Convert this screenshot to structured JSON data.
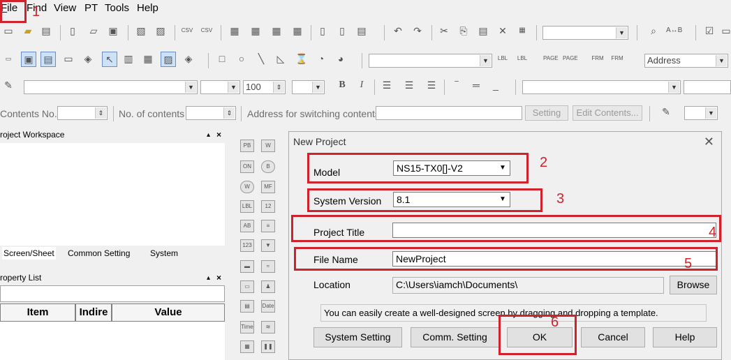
{
  "menu": {
    "file": "File",
    "find": "Find",
    "view": "View",
    "pt": "PT",
    "tools": "Tools",
    "help": "Help"
  },
  "toolbar3": {
    "font_size": "100"
  },
  "toolbar4": {
    "contents_no_label": "Contents No.",
    "no_of_contents_label": "No. of contents",
    "address_switching_label": "Address for switching contents",
    "setting_button": "Setting",
    "edit_contents_button": "Edit Contents..."
  },
  "address_combo": "Address",
  "workspace": {
    "title": "roject Workspace",
    "tabs": [
      "Screen/Sheet",
      "Common Setting",
      "System"
    ]
  },
  "property_list": {
    "title": "roperty List",
    "columns": [
      "Item",
      "Indire",
      "Value"
    ]
  },
  "dialog": {
    "title": "New Project",
    "model_label": "Model",
    "model_value": "NS15-TX0[]-V2",
    "system_version_label": "System Version",
    "system_version_value": "8.1",
    "project_title_label": "Project Title",
    "project_title_value": "",
    "file_name_label": "File Name",
    "file_name_value": "NewProject",
    "location_label": "Location",
    "location_value": "C:\\Users\\iamch\\Documents\\",
    "browse_button": "Browse",
    "hint": "You can easily create a well-designed screen by dragging and dropping a template.",
    "system_setting_button": "System Setting",
    "comm_setting_button": "Comm. Setting",
    "ok_button": "OK",
    "cancel_button": "Cancel",
    "help_button": "Help"
  },
  "annotations": [
    "1",
    "2",
    "3",
    "4",
    "5",
    "6"
  ],
  "colors": {
    "annotation_red": "#d0222c",
    "background": "#f0f0f0"
  }
}
